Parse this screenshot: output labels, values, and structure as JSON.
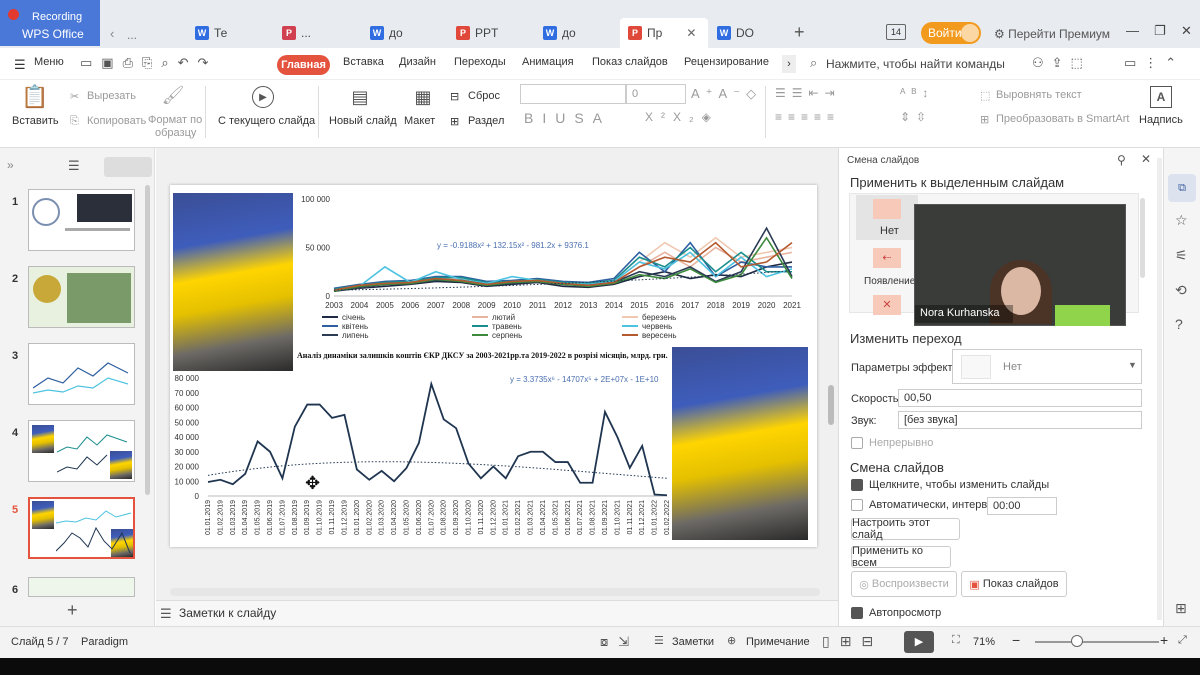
{
  "titlebar": {
    "recording": "Recording",
    "app_name": "WPS Office",
    "tabs": [
      {
        "label": "Те",
        "kind": "w"
      },
      {
        "label": "...",
        "kind": "r"
      },
      {
        "label": "до",
        "kind": "w"
      },
      {
        "label": "PPT",
        "kind": "p"
      },
      {
        "label": "до",
        "kind": "w"
      },
      {
        "label": "Пр",
        "kind": "p",
        "active": true
      },
      {
        "label": "DO",
        "kind": "w"
      }
    ],
    "login_label": "Войти",
    "premium_label": "Перейти Премиум"
  },
  "menu": {
    "menu_label": "Меню",
    "tabs": [
      "Главная",
      "Вставка",
      "Дизайн",
      "Переходы",
      "Анимация",
      "Показ слайдов",
      "Рецензирование"
    ],
    "active_tab": "Главная",
    "search_placeholder": "Нажмите, чтобы найти команды"
  },
  "ribbon": {
    "paste": "Вставить",
    "cut": "Вырезать",
    "copy": "Копировать",
    "format_painter_1": "Формат по",
    "format_painter_2": "образцу",
    "from_current": "С текущего слайда",
    "new_slide": "Новый слайд",
    "layout": "Макет",
    "reset": "Сброс",
    "section": "Раздел",
    "font_size": "0",
    "align_text": "Выровнять текст",
    "smartart": "Преобразовать в SmartArt",
    "text_box": "Надпись"
  },
  "thumbnails": {
    "numbers": [
      "1",
      "2",
      "3",
      "4",
      "5",
      "6"
    ],
    "selected": "5"
  },
  "slide": {
    "top_chart_equation": "y = -0.9188x² + 132.15x² - 981.2x + 9376.1",
    "caption": "Аналіз динаміки  залишків коштів ЄКР ДКСУ за 2003-2021рр.та 2019-2022 в розрізі місяців, млрд. грн.",
    "bottom_chart_equation": "y = 3.3735x⁶ - 14707x⁵ + 2E+07x - 1E+10"
  },
  "chart_data": [
    {
      "type": "line",
      "title": "",
      "x": [
        "2003",
        "2004",
        "2005",
        "2006",
        "2007",
        "2008",
        "2009",
        "2010",
        "2011",
        "2012",
        "2013",
        "2014",
        "2015",
        "2016",
        "2017",
        "2018",
        "2019",
        "2020",
        "2021"
      ],
      "ylim": [
        0,
        100000
      ],
      "yticks": [
        "100 000",
        "50 000",
        "0"
      ],
      "grid": false,
      "legend": "bottom",
      "series": [
        {
          "name": "січень",
          "color": "#1f2a44",
          "values": [
            5000,
            8000,
            10000,
            12000,
            15000,
            14000,
            10000,
            12000,
            14000,
            10000,
            9000,
            12000,
            20000,
            25000,
            18000,
            22000,
            20000,
            30000,
            35000
          ]
        },
        {
          "name": "лютий",
          "color": "#e8b4a0",
          "values": [
            6000,
            9000,
            12000,
            14000,
            17000,
            16000,
            12000,
            14000,
            15000,
            12000,
            11000,
            14000,
            30000,
            45000,
            30000,
            50000,
            35000,
            40000,
            45000
          ]
        },
        {
          "name": "березень",
          "color": "#f0c8b0",
          "values": [
            7000,
            10000,
            13000,
            15000,
            18000,
            18000,
            13000,
            15000,
            16000,
            13000,
            12000,
            15000,
            35000,
            55000,
            40000,
            60000,
            40000,
            45000,
            50000
          ]
        },
        {
          "name": "квітень",
          "color": "#2f5fa0",
          "values": [
            8000,
            12000,
            15000,
            16000,
            20000,
            20000,
            15000,
            16000,
            18000,
            15000,
            14000,
            18000,
            45000,
            25000,
            55000,
            20000,
            35000,
            30000,
            30000
          ]
        },
        {
          "name": "травень",
          "color": "#1a8e8e",
          "values": [
            7000,
            11000,
            14000,
            15000,
            19000,
            19000,
            14000,
            15000,
            17000,
            14000,
            13000,
            16000,
            40000,
            30000,
            50000,
            25000,
            45000,
            25000,
            25000
          ]
        },
        {
          "name": "червень",
          "color": "#4cc3e0",
          "values": [
            6000,
            10000,
            30000,
            14000,
            25000,
            17000,
            13000,
            20000,
            16000,
            13000,
            12000,
            15000,
            35000,
            28000,
            45000,
            20000,
            40000,
            20000,
            28000
          ]
        },
        {
          "name": "липень",
          "color": "#2b3a55",
          "values": [
            5000,
            9000,
            12000,
            13000,
            16000,
            16000,
            12000,
            13000,
            15000,
            12000,
            11000,
            14000,
            25000,
            20000,
            30000,
            15000,
            25000,
            70000,
            20000
          ]
        },
        {
          "name": "серпень",
          "color": "#3d8a3d",
          "values": [
            5000,
            10000,
            12000,
            13000,
            17000,
            15000,
            11000,
            14000,
            15000,
            12000,
            10000,
            13000,
            22000,
            18000,
            28000,
            14000,
            22000,
            60000,
            18000
          ]
        },
        {
          "name": "вересень",
          "color": "#b45a30",
          "values": [
            6000,
            11000,
            13000,
            14000,
            18000,
            16000,
            12000,
            15000,
            16000,
            13000,
            11000,
            14000,
            30000,
            40000,
            35000,
            55000,
            30000,
            35000,
            55000
          ]
        }
      ]
    },
    {
      "type": "line",
      "title": "",
      "ylim": [
        0,
        80000
      ],
      "yticks": [
        "80 000",
        "70 000",
        "60 000",
        "50 000",
        "40 000",
        "30 000",
        "20 000",
        "10 000",
        "0"
      ],
      "x": [
        "01.01.2019",
        "01.02.2019",
        "01.03.2019",
        "01.04.2019",
        "01.05.2019",
        "01.06.2019",
        "01.07.2019",
        "01.08.2019",
        "01.09.2019",
        "01.10.2019",
        "01.11.2019",
        "01.12.2019",
        "01.01.2020",
        "01.02.2020",
        "01.03.2020",
        "01.04.2020",
        "01.05.2020",
        "01.06.2020",
        "01.07.2020",
        "01.08.2020",
        "01.09.2020",
        "01.10.2020",
        "01.11.2020",
        "01.12.2020",
        "01.01.2021",
        "01.02.2021",
        "01.03.2021",
        "01.04.2021",
        "01.05.2021",
        "01.06.2021",
        "01.07.2021",
        "01.08.2021",
        "01.09.2021",
        "01.10.2021",
        "01.11.2021",
        "01.12.2021",
        "01.01.2022",
        "01.02.2022"
      ],
      "series": [
        {
          "name": "",
          "color": "#1f3550",
          "values": [
            9500,
            11000,
            8000,
            15000,
            37000,
            30000,
            12000,
            47000,
            62000,
            62000,
            53000,
            55000,
            18000,
            11000,
            17000,
            10000,
            19000,
            36000,
            76000,
            52000,
            46000,
            22000,
            12000,
            20000,
            12000,
            27000,
            30000,
            30000,
            23000,
            23000,
            9000,
            9000,
            57000,
            40000,
            19000,
            34000,
            1000,
            500
          ]
        }
      ]
    }
  ],
  "presenter": {
    "name": "Nora  Kurhanska"
  },
  "transition_panel": {
    "header": "Смена слайдов",
    "apply_title": "Применить к выделенным слайдам",
    "effect_none": "Нет",
    "effect_appear": "Появление",
    "modify_title": "Изменить переход",
    "params_label": "Параметры эффектов:",
    "params_value": "Нет",
    "speed_label": "Скорость:",
    "speed_value": "00,50",
    "sound_label": "Звук:",
    "sound_value": "[без звука]",
    "loop_label": "Непрерывно",
    "advance_title": "Смена слайдов",
    "on_click_label": "Щелкните, чтобы изменить слайды",
    "auto_label": "Автоматически, интервал:",
    "auto_value": "00:00",
    "config_button": "Настроить этот слайд",
    "apply_all_button": "Применить ко всем",
    "play_button": "Воспроизвести",
    "slideshow_button": "Показ слайдов",
    "autopreview_label": "Автопросмотр"
  },
  "notes": {
    "label": "Заметки к слайду"
  },
  "status": {
    "slide_counter": "Слайд 5 / 7",
    "theme": "Paradigm",
    "notes_btn": "Заметки",
    "comment_btn": "Примечание",
    "zoom": "71%"
  }
}
